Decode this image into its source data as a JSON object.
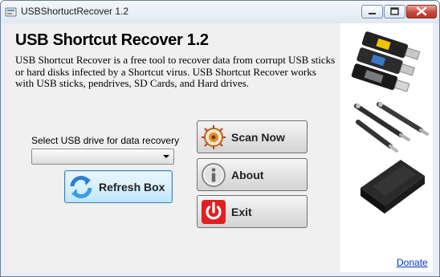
{
  "window": {
    "title": "USBShortuctRecover 1.2",
    "controls": [
      "minimize-icon",
      "maximize-icon",
      "close-icon"
    ]
  },
  "main": {
    "heading": "USB Shortcut Recover 1.2",
    "description": "USB Shortcut Recover is a free tool to recover data from corrupt USB sticks or hard disks infected by a Shortcut virus. USB Shortcut Recover works with USB sticks, pendrives, SD Cards, and Hard drives.",
    "drive_select": {
      "label": "Select USB drive for data recovery",
      "value": ""
    },
    "buttons": {
      "refresh": "Refresh Box",
      "scan": "Scan Now",
      "about": "About",
      "exit": "Exit"
    }
  },
  "sidebar": {
    "images": [
      "usb-sticks-image",
      "pens-image",
      "hard-drive-image"
    ],
    "donate_link": "Donate"
  },
  "colors": {
    "title_bar": "#dfe8f2",
    "close_button": "#c8473a",
    "link": "#0033cc",
    "refresh_accent": "#bee6fd"
  }
}
